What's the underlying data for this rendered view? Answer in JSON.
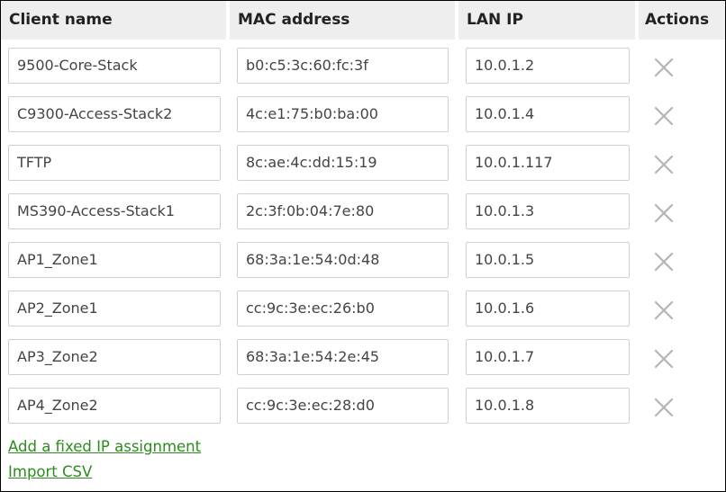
{
  "table": {
    "columns": {
      "client_name": "Client name",
      "mac_address": "MAC address",
      "lan_ip": "LAN IP",
      "actions": "Actions"
    },
    "rows": [
      {
        "client_name": "9500-Core-Stack",
        "mac": "b0:c5:3c:60:fc:3f",
        "ip": "10.0.1.2",
        "action_icon": "close-icon"
      },
      {
        "client_name": "C9300-Access-Stack2",
        "mac": "4c:e1:75:b0:ba:00",
        "ip": "10.0.1.4",
        "action_icon": "close-icon"
      },
      {
        "client_name": "TFTP",
        "mac": "8c:ae:4c:dd:15:19",
        "ip": "10.0.1.117",
        "action_icon": "close-icon"
      },
      {
        "client_name": "MS390-Access-Stack1",
        "mac": "2c:3f:0b:04:7e:80",
        "ip": "10.0.1.3",
        "action_icon": "close-icon"
      },
      {
        "client_name": "AP1_Zone1",
        "mac": "68:3a:1e:54:0d:48",
        "ip": "10.0.1.5",
        "action_icon": "close-icon"
      },
      {
        "client_name": "AP2_Zone1",
        "mac": "cc:9c:3e:ec:26:b0",
        "ip": "10.0.1.6",
        "action_icon": "close-icon"
      },
      {
        "client_name": "AP3_Zone2",
        "mac": "68:3a:1e:54:2e:45",
        "ip": "10.0.1.7",
        "action_icon": "close-icon"
      },
      {
        "client_name": "AP4_Zone2",
        "mac": "cc:9c:3e:ec:28:d0",
        "ip": "10.0.1.8",
        "action_icon": "close-icon"
      }
    ]
  },
  "links": {
    "add_fixed_ip": "Add a fixed IP assignment",
    "import_csv": "Import CSV"
  },
  "colors": {
    "link": "#2e8b1f",
    "header_bg": "#eeeeee",
    "delete_icon": "#b5b5b5"
  }
}
